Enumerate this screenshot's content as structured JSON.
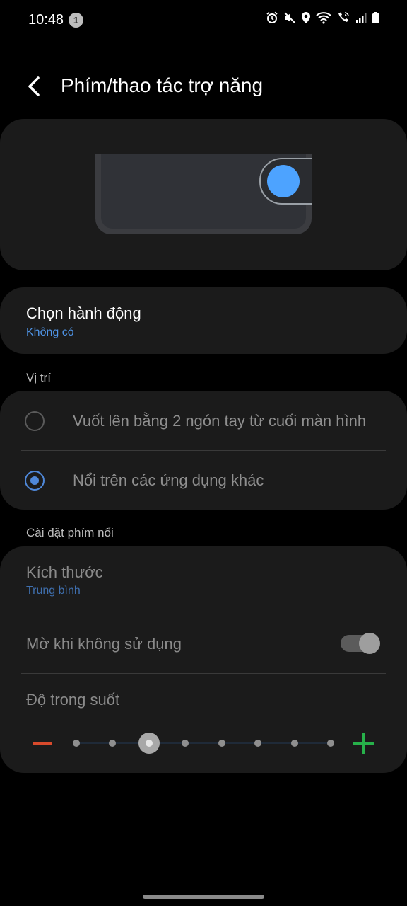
{
  "status_bar": {
    "time": "10:48",
    "notification_count": "1",
    "icons": [
      "alarm-icon",
      "mute-icon",
      "location-icon",
      "wifi-icon",
      "wifi-calling-icon",
      "signal-icon",
      "battery-icon"
    ]
  },
  "app_bar": {
    "title": "Phím/thao tác trợ năng",
    "back_icon": "back-arrow-icon"
  },
  "preview": {
    "accent_color": "#4da3ff"
  },
  "action": {
    "title": "Chọn hành động",
    "value": "Không có"
  },
  "position": {
    "section_label": "Vị trí",
    "options": [
      {
        "label": "Vuốt lên bằng 2 ngón tay từ cuối màn hình",
        "selected": false
      },
      {
        "label": "Nổi trên các ứng dụng khác",
        "selected": true
      }
    ]
  },
  "floating_settings": {
    "section_label": "Cài đặt phím nổi",
    "size_title": "Kích thước",
    "size_value": "Trung bình",
    "dim_title": "Mờ khi không sử dụng",
    "dim_enabled": true,
    "transparency_title": "Độ trong suốt",
    "transparency": {
      "level": 3,
      "steps": 8
    },
    "minus_color": "#d84a2c",
    "plus_color": "#27b14a"
  }
}
